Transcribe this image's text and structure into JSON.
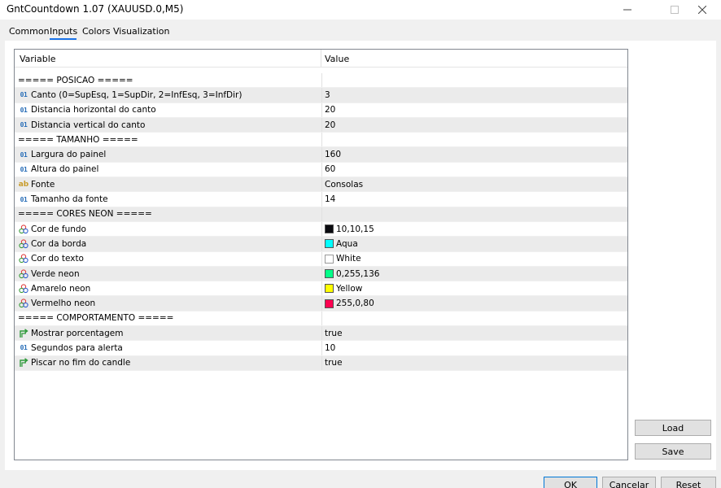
{
  "window": {
    "title": "GntCountdown 1.07 (XAUUSD.0,M5)"
  },
  "tabs": [
    {
      "label": "Common"
    },
    {
      "label": "Inputs",
      "active": true
    },
    {
      "label": "Colors"
    },
    {
      "label": "Visualization"
    }
  ],
  "grid": {
    "columns": {
      "variable": "Variable",
      "value": "Value"
    },
    "rows": [
      {
        "type": "section",
        "label": "===== POSICAO =====",
        "value": ""
      },
      {
        "type": "int",
        "label": "Canto (0=SupEsq, 1=SupDir, 2=InfEsq, 3=InfDir)",
        "value": "3"
      },
      {
        "type": "int",
        "label": "Distancia horizontal do canto",
        "value": "20"
      },
      {
        "type": "int",
        "label": "Distancia vertical do canto",
        "value": "20"
      },
      {
        "type": "section",
        "label": "===== TAMANHO =====",
        "value": ""
      },
      {
        "type": "int",
        "label": "Largura do painel",
        "value": "160"
      },
      {
        "type": "int",
        "label": "Altura do painel",
        "value": "60"
      },
      {
        "type": "string",
        "label": "Fonte",
        "value": "Consolas"
      },
      {
        "type": "int",
        "label": "Tamanho da fonte",
        "value": "14"
      },
      {
        "type": "section",
        "label": "===== CORES NEON =====",
        "value": ""
      },
      {
        "type": "color",
        "label": "Cor de fundo",
        "value": "10,10,15",
        "swatch": "#0a0a0f"
      },
      {
        "type": "color",
        "label": "Cor da borda",
        "value": "Aqua",
        "swatch": "#00ffff"
      },
      {
        "type": "color",
        "label": "Cor do texto",
        "value": "White",
        "swatch": "#ffffff"
      },
      {
        "type": "color",
        "label": "Verde neon",
        "value": "0,255,136",
        "swatch": "#00ff88"
      },
      {
        "type": "color",
        "label": "Amarelo neon",
        "value": "Yellow",
        "swatch": "#ffff00"
      },
      {
        "type": "color",
        "label": "Vermelho neon",
        "value": "255,0,80",
        "swatch": "#ff0050"
      },
      {
        "type": "section",
        "label": "===== COMPORTAMENTO =====",
        "value": ""
      },
      {
        "type": "bool",
        "label": "Mostrar porcentagem",
        "value": "true"
      },
      {
        "type": "int",
        "label": "Segundos para alerta",
        "value": "10"
      },
      {
        "type": "bool",
        "label": "Piscar no fim do candle",
        "value": "true"
      }
    ]
  },
  "icons": {
    "int": "01",
    "string": "ab"
  },
  "buttons": {
    "load": "Load",
    "save": "Save",
    "ok": "OK",
    "cancel": "Cancelar",
    "reset": "Reset"
  },
  "colors": {
    "accent": "#1a73e8",
    "row_alt": "#ebebeb"
  }
}
